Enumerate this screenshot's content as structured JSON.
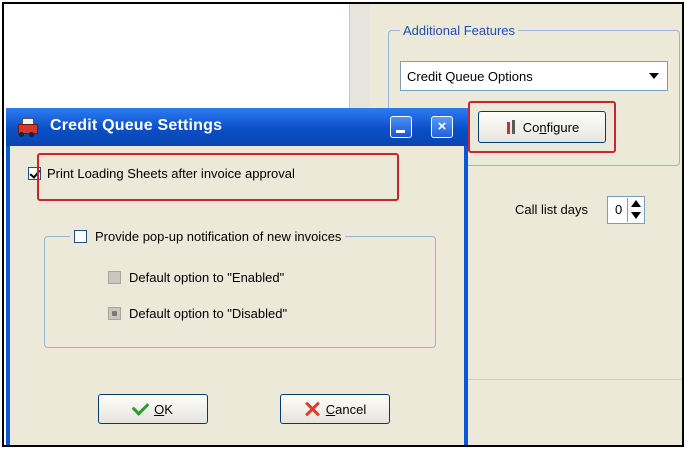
{
  "background_window": {
    "additional_features": {
      "legend": "Additional Features",
      "dropdown_value": "Credit Queue Options",
      "configure_label_before": "Co",
      "configure_label_accel": "n",
      "configure_label_after": "figure"
    },
    "call_list": {
      "label": "Call list days",
      "value": "0"
    }
  },
  "dialog": {
    "title": "Credit Queue Settings",
    "close_glyph": "×",
    "print_loading_label": "Print Loading Sheets after invoice approval",
    "print_loading_checked": true,
    "notifications": {
      "label": "Provide pop-up notification of new invoices",
      "checked": false,
      "option_enabled_label": "Default option to \"Enabled\"",
      "option_disabled_label": "Default option to \"Disabled\"",
      "selected": "Disabled"
    },
    "ok_accel": "O",
    "ok_rest": "K",
    "cancel_accel": "C",
    "cancel_rest": "ancel"
  },
  "colors": {
    "highlight": "#c8262c",
    "titlebar": "#0a4fc8",
    "group_legend": "#1f4fb5",
    "panel": "#ece9d8"
  },
  "icons": [
    "truck-app-icon",
    "minimize-icon",
    "close-icon",
    "configure-icon",
    "ok-check-icon",
    "cancel-x-icon",
    "dropdown-caret-icon",
    "spin-up-icon",
    "spin-down-icon"
  ]
}
